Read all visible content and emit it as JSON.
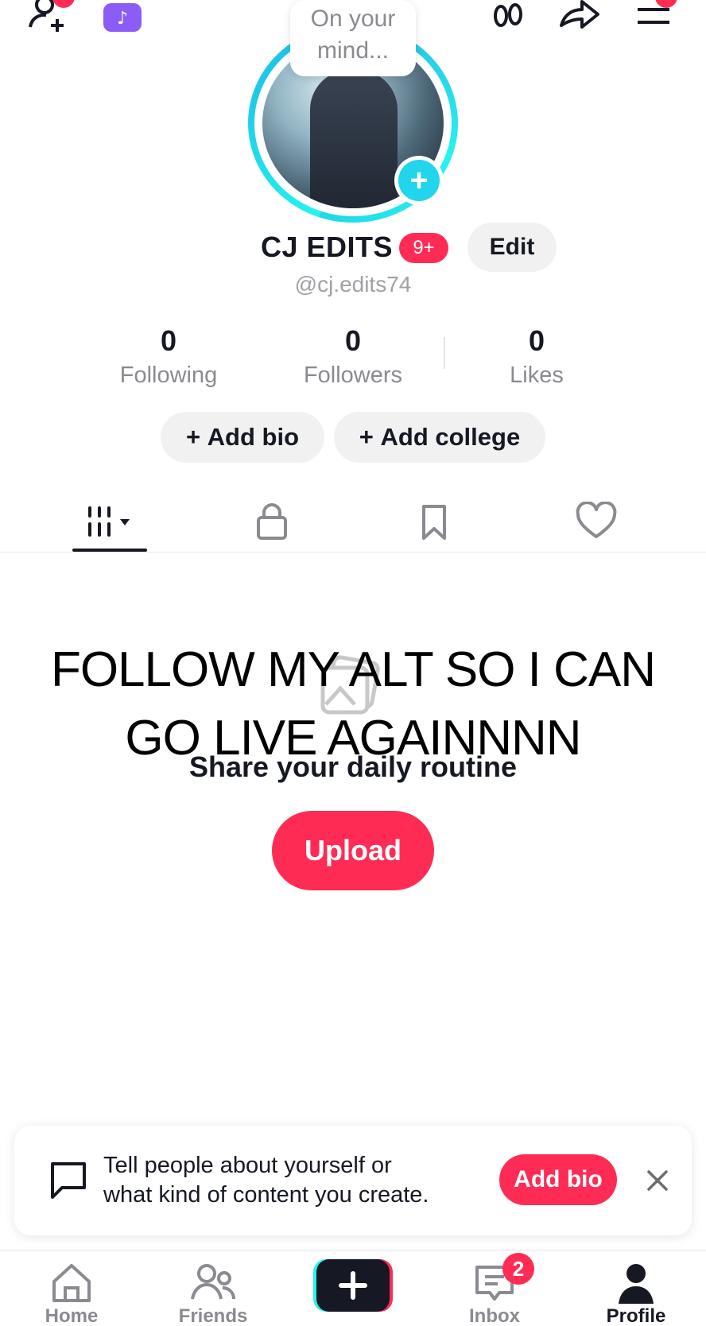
{
  "topbar": {
    "icons": [
      "add-friend-icon",
      "tiktok-coin-icon",
      "footprints-icon",
      "share-icon",
      "menu-icon"
    ]
  },
  "profile": {
    "status_bubble": "On your mind...",
    "display_name": "CJ EDITS",
    "notification_badge": "9+",
    "edit_label": "Edit",
    "username": "@cj.edits74"
  },
  "stats": [
    {
      "value": "0",
      "label": "Following"
    },
    {
      "value": "0",
      "label": "Followers"
    },
    {
      "value": "0",
      "label": "Likes"
    }
  ],
  "actions": {
    "add_bio": "Add bio",
    "add_college": "Add college"
  },
  "tabs": [
    "videos-grid-icon",
    "lock-icon",
    "bookmark-icon",
    "heart-icon"
  ],
  "overlay_text": "FOLLOW MY ALT SO I CAN GO LIVE AGAINNNN",
  "empty_state": {
    "title": "Share your daily routine",
    "upload_label": "Upload"
  },
  "bio_prompt": {
    "text_line1": "Tell people about yourself or",
    "text_line2": "what kind of content you create.",
    "button_label": "Add bio"
  },
  "bottom_nav": {
    "home": "Home",
    "friends": "Friends",
    "inbox": "Inbox",
    "inbox_badge": "2",
    "profile": "Profile"
  },
  "colors": {
    "accent": "#fe2c55",
    "ring": "#25f4ee",
    "text": "#161823",
    "muted": "#8a8b91"
  }
}
